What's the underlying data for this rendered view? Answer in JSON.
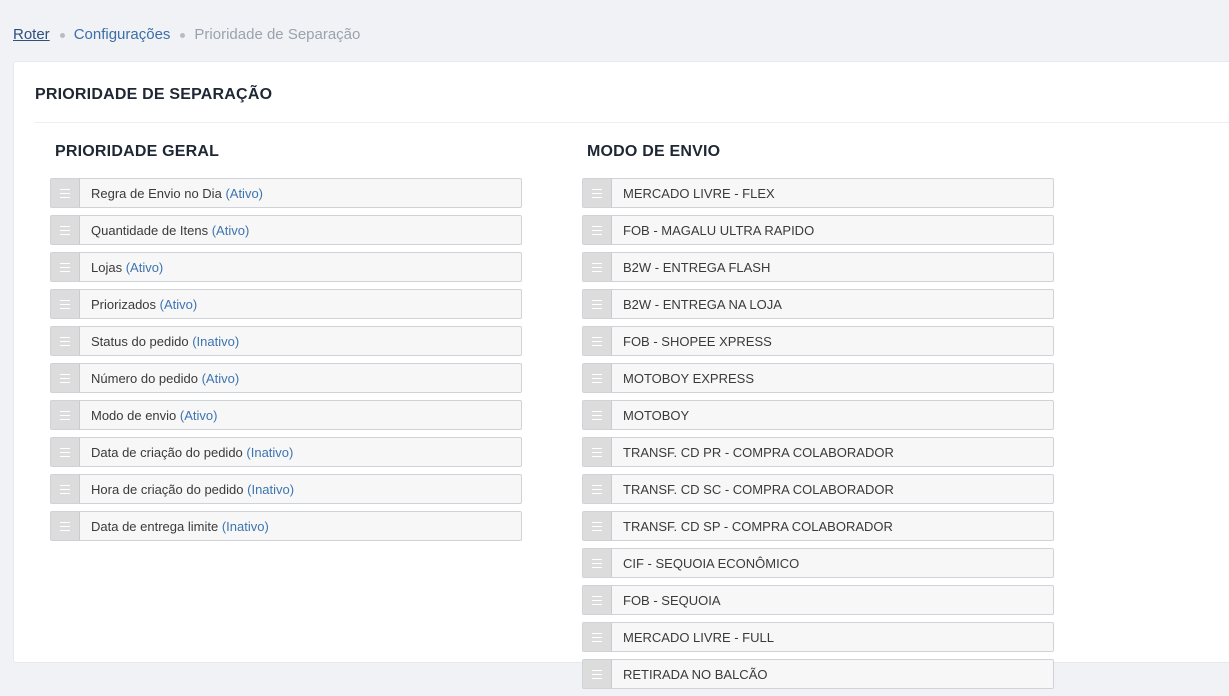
{
  "breadcrumb": {
    "root": "Roter",
    "section": "Configurações",
    "current": "Prioridade de Separação"
  },
  "page": {
    "title": "PRIORIDADE DE SEPARAÇÃO"
  },
  "general": {
    "title": "PRIORIDADE GERAL",
    "items": [
      {
        "label": "Regra de Envio no Dia",
        "status": "(Ativo)"
      },
      {
        "label": "Quantidade de Itens",
        "status": "(Ativo)"
      },
      {
        "label": "Lojas",
        "status": "(Ativo)"
      },
      {
        "label": "Priorizados",
        "status": "(Ativo)"
      },
      {
        "label": "Status do pedido",
        "status": "(Inativo)"
      },
      {
        "label": "Número do pedido",
        "status": "(Ativo)"
      },
      {
        "label": "Modo de envio",
        "status": "(Ativo)"
      },
      {
        "label": "Data de criação do pedido",
        "status": "(Inativo)"
      },
      {
        "label": "Hora de criação do pedido",
        "status": "(Inativo)"
      },
      {
        "label": "Data de entrega limite",
        "status": "(Inativo)"
      }
    ]
  },
  "shipping": {
    "title": "MODO DE ENVIO",
    "items": [
      {
        "label": "MERCADO LIVRE - FLEX"
      },
      {
        "label": "FOB - MAGALU ULTRA RAPIDO"
      },
      {
        "label": "B2W - ENTREGA FLASH"
      },
      {
        "label": "B2W - ENTREGA NA LOJA"
      },
      {
        "label": "FOB - SHOPEE XPRESS"
      },
      {
        "label": "MOTOBOY EXPRESS"
      },
      {
        "label": "MOTOBOY"
      },
      {
        "label": "TRANSF. CD PR - COMPRA COLABORADOR"
      },
      {
        "label": "TRANSF. CD SC - COMPRA COLABORADOR"
      },
      {
        "label": "TRANSF. CD SP - COMPRA COLABORADOR"
      },
      {
        "label": "CIF - SEQUOIA ECONÔMICO"
      },
      {
        "label": "FOB - SEQUOIA"
      },
      {
        "label": "MERCADO LIVRE - FULL"
      },
      {
        "label": "RETIRADA NO BALCÃO"
      }
    ]
  },
  "icons": {
    "handle": "drag-handle-icon",
    "breadcrumb_separator": "dot-separator-icon"
  },
  "colors": {
    "link": "#3c6ea8",
    "status": "#3d74b0",
    "title": "#1e2733",
    "background": "#f1f2f6"
  }
}
